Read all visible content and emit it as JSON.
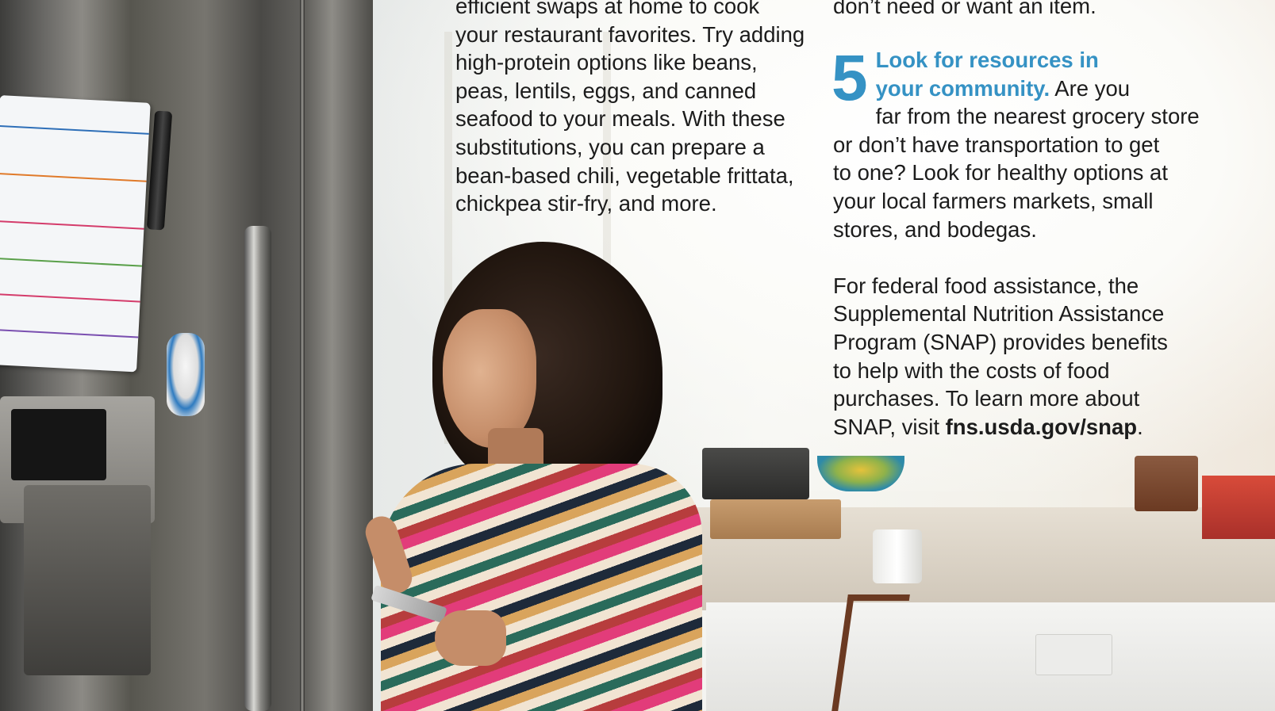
{
  "left_column": {
    "lines": [
      "efficient swaps at home to cook",
      "your restaurant favorites. Try adding",
      "high-protein options like beans,",
      "peas, lentils, eggs, and canned",
      "seafood to your meals. With these",
      "substitutions, you can prepare a",
      "bean-based chili, vegetable frittata,",
      "chickpea stir-fry, and more."
    ]
  },
  "right_column_top": {
    "line": "don’t need or want an item."
  },
  "tip5": {
    "number": "5",
    "heading_line1": "Look for resources in",
    "heading_line2": "your community.",
    "after_heading": " Are you",
    "lines": [
      "far from the nearest grocery store",
      "or don’t have transportation to get",
      "to one? Look for healthy options at",
      "your local farmers markets, small",
      "stores, and bodegas."
    ]
  },
  "snap": {
    "lines": [
      "For federal food assistance, the",
      "Supplemental Nutrition Assistance",
      "Program (SNAP) provides benefits",
      "to help with the costs of food",
      "purchases. To learn more about"
    ],
    "last_prefix": "SNAP, visit ",
    "link": "fns.usda.gov/snap",
    "last_suffix": "."
  },
  "colors": {
    "accent": "#3592c4",
    "text": "#1c1c1c"
  }
}
